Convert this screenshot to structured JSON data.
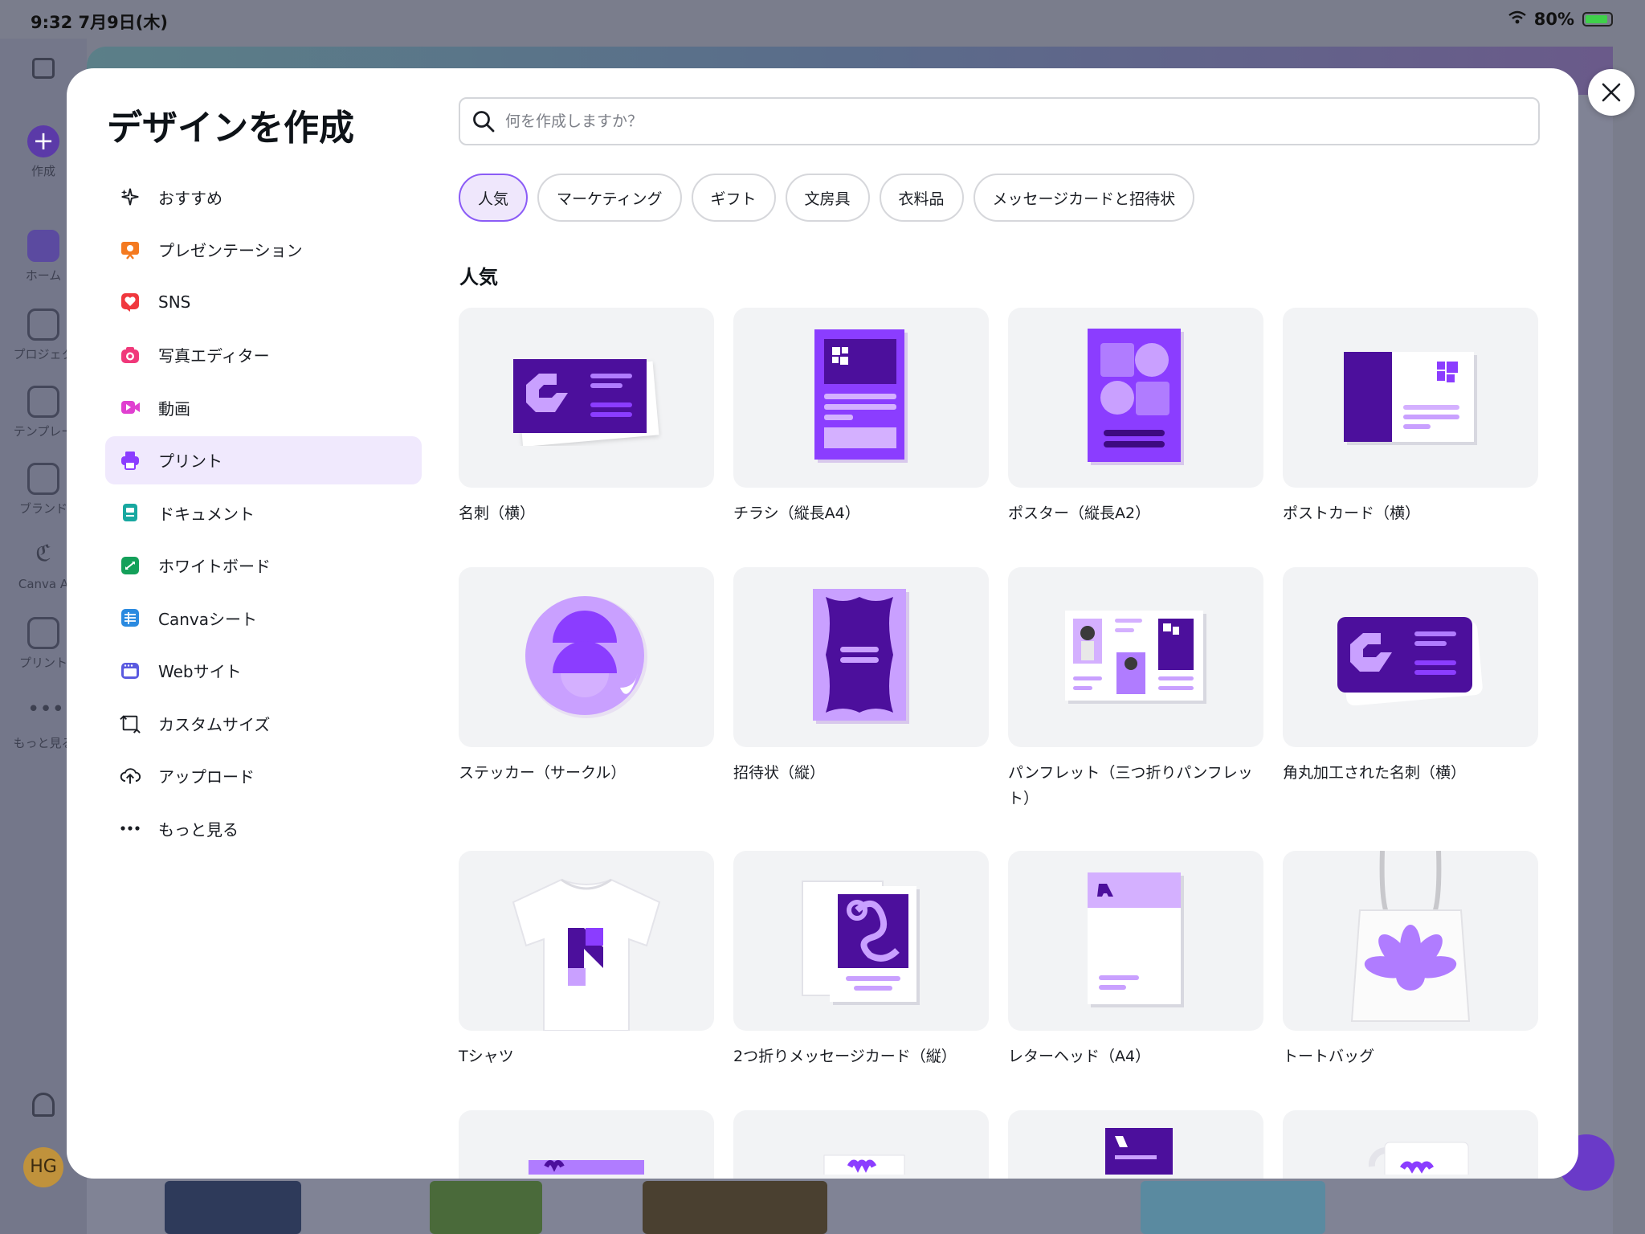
{
  "status_bar": {
    "time": "9:32  7月9日(木)",
    "battery": "80%"
  },
  "background_rail": [
    {
      "label": "作成"
    },
    {
      "label": "ホーム"
    },
    {
      "label": "プロジェク"
    },
    {
      "label": "テンプレー"
    },
    {
      "label": "ブランド"
    },
    {
      "label": "Canva A"
    },
    {
      "label": "プリント"
    },
    {
      "label": "もっと見る"
    }
  ],
  "background_avatar": "HG",
  "modal": {
    "title": "デザインを作成",
    "search_placeholder": "何を作成しますか？",
    "sidebar": [
      {
        "label": "おすすめ",
        "icon": "sparkle-icon",
        "color": "#1a1d23"
      },
      {
        "label": "プレゼンテーション",
        "icon": "presentation-icon",
        "color": "#f47a20"
      },
      {
        "label": "SNS",
        "icon": "heart-icon",
        "color": "#f0383e"
      },
      {
        "label": "写真エディター",
        "icon": "camera-icon",
        "color": "#f0387a"
      },
      {
        "label": "動画",
        "icon": "video-icon",
        "color": "#e040d0"
      },
      {
        "label": "プリント",
        "icon": "printer-icon",
        "color": "#8b3dff",
        "active": true
      },
      {
        "label": "ドキュメント",
        "icon": "document-icon",
        "color": "#18a8a0"
      },
      {
        "label": "ホワイトボード",
        "icon": "whiteboard-icon",
        "color": "#14a05a"
      },
      {
        "label": "Canvaシート",
        "icon": "sheet-icon",
        "color": "#2a8ae0"
      },
      {
        "label": "Webサイト",
        "icon": "website-icon",
        "color": "#5a5ae0"
      },
      {
        "label": "カスタムサイズ",
        "icon": "custom-size-icon",
        "color": "#1a1d23"
      },
      {
        "label": "アップロード",
        "icon": "upload-icon",
        "color": "#1a1d23"
      },
      {
        "label": "もっと見る",
        "icon": "more-icon",
        "color": "#1a1d23"
      }
    ],
    "chips": [
      {
        "label": "人気",
        "active": true
      },
      {
        "label": "マーケティング"
      },
      {
        "label": "ギフト"
      },
      {
        "label": "文房具"
      },
      {
        "label": "衣料品"
      },
      {
        "label": "メッセージカードと招待状"
      }
    ],
    "section_title": "人気",
    "cards": [
      {
        "label": "名刺（横）",
        "art": "business-card"
      },
      {
        "label": "チラシ（縦長A4）",
        "art": "flyer"
      },
      {
        "label": "ポスター（縦長A2）",
        "art": "poster"
      },
      {
        "label": "ポストカード（横）",
        "art": "postcard"
      },
      {
        "label": "ステッカー（サークル）",
        "art": "sticker"
      },
      {
        "label": "招待状（縦）",
        "art": "invitation"
      },
      {
        "label": "パンフレット（三つ折りパンフレット）",
        "art": "brochure"
      },
      {
        "label": "角丸加工された名刺（横）",
        "art": "rounded-card"
      },
      {
        "label": "Tシャツ",
        "art": "tshirt"
      },
      {
        "label": "2つ折りメッセージカード（縦）",
        "art": "folded-card"
      },
      {
        "label": "レターヘッド（A4）",
        "art": "letterhead"
      },
      {
        "label": "トートバッグ",
        "art": "tote"
      },
      {
        "label": "",
        "art": "partial-1"
      },
      {
        "label": "",
        "art": "partial-2"
      },
      {
        "label": "",
        "art": "partial-3"
      },
      {
        "label": "",
        "art": "partial-4"
      }
    ]
  },
  "colors": {
    "accent": "#8b3dff",
    "deep_purple": "#4c0f9c",
    "light_purple": "#d4b0ff",
    "active_bg": "#f0e9fd"
  }
}
